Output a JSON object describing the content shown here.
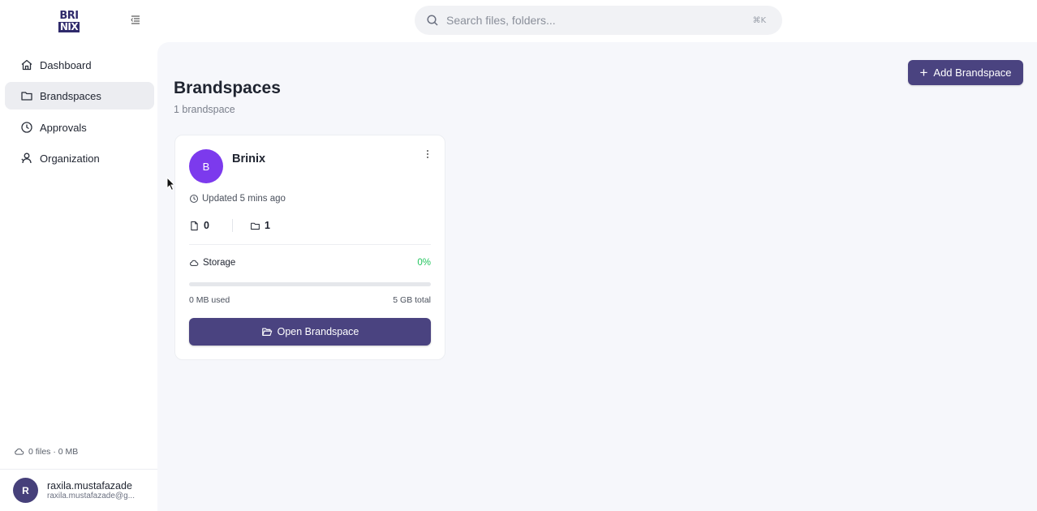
{
  "app": {
    "logo_line1": "BRI",
    "logo_line2": "NIX"
  },
  "search": {
    "placeholder": "Search files, folders...",
    "shortcut": "⌘K"
  },
  "sidebar": {
    "items": [
      {
        "label": "Dashboard",
        "icon": "home-icon",
        "active": false
      },
      {
        "label": "Brandspaces",
        "icon": "folder-icon",
        "active": true
      },
      {
        "label": "Approvals",
        "icon": "clock-icon",
        "active": false
      },
      {
        "label": "Organization",
        "icon": "users-icon",
        "active": false
      }
    ],
    "storage_summary": "0 files · 0 MB",
    "user": {
      "initial": "R",
      "name": "raxila.mustafazade",
      "email": "raxila.mustafazade@g..."
    }
  },
  "main": {
    "title": "Brandspaces",
    "subtitle": "1 brandspace",
    "add_button": "Add Brandspace",
    "cards": [
      {
        "initial": "B",
        "name": "Brinix",
        "avatar_color": "#7c3aed",
        "updated": "Updated 5 mins ago",
        "files_count": "0",
        "folders_count": "1",
        "storage_label": "Storage",
        "storage_percent": "0%",
        "storage_fraction": 0,
        "used": "0 MB used",
        "total": "5 GB total",
        "open_button": "Open Brandspace"
      }
    ]
  },
  "colors": {
    "accent": "#4a4380",
    "success": "#22c55e",
    "main_bg": "#f6f7fb"
  }
}
